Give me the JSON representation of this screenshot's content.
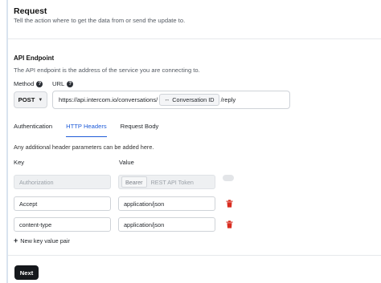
{
  "request": {
    "title": "Request",
    "subtitle": "Tell the action where to get the data from or send the update to."
  },
  "endpoint": {
    "title": "API Endpoint",
    "subtitle": "The API endpoint is the address of the service you are connecting to.",
    "method_label": "Method",
    "url_label": "URL",
    "method_value": "POST",
    "url_prefix": "https://api.intercom.io/conversations/",
    "url_chip": "Conversation ID",
    "url_suffix": "/reply"
  },
  "tabs": [
    {
      "label": "Authentication"
    },
    {
      "label": "HTTP Headers"
    },
    {
      "label": "Request Body"
    }
  ],
  "headers": {
    "description": "Any additional header parameters can be added here.",
    "key_label": "Key",
    "value_label": "Value",
    "rows": [
      {
        "key": "Authorization",
        "value_chip": "Bearer",
        "value": "REST API Token"
      },
      {
        "key": "Accept",
        "value": "application/json"
      },
      {
        "key": "content-type",
        "value": "application/json"
      }
    ],
    "add_label": "New key value pair"
  },
  "actions": {
    "next_label": "Next"
  },
  "colors": {
    "accent": "#1e5bd8",
    "delete": "#d92d20",
    "primary_button": "#15181c"
  },
  "icons": {
    "help": "question-circle-icon",
    "method_caret": "chevron-down-icon",
    "chip": "variable-icon",
    "delete": "trash-icon",
    "add": "plus-icon"
  }
}
